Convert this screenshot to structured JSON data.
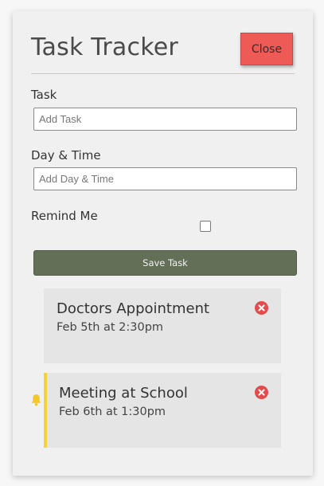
{
  "header": {
    "title": "Task Tracker",
    "close_label": "Close"
  },
  "form": {
    "task_label": "Task",
    "task_placeholder": "Add Task",
    "task_value": "",
    "day_label": "Day & Time",
    "day_placeholder": "Add Day & Time",
    "day_value": "",
    "remind_label": "Remind Me",
    "remind_checked": false,
    "save_label": "Save Task"
  },
  "tasks": [
    {
      "text": "Doctors Appointment",
      "day": "Feb 5th at 2:30pm",
      "reminder": false,
      "delete_icon": "delete-icon"
    },
    {
      "text": "Meeting at School",
      "day": "Feb 6th at 1:30pm",
      "reminder": true,
      "delete_icon": "delete-icon",
      "reminder_icon": "bell-icon"
    }
  ],
  "colors": {
    "close_button": "#ee5b57",
    "save_button": "#636f57",
    "reminder_border": "#f3d33c",
    "delete_icon": "#e14b4b"
  }
}
